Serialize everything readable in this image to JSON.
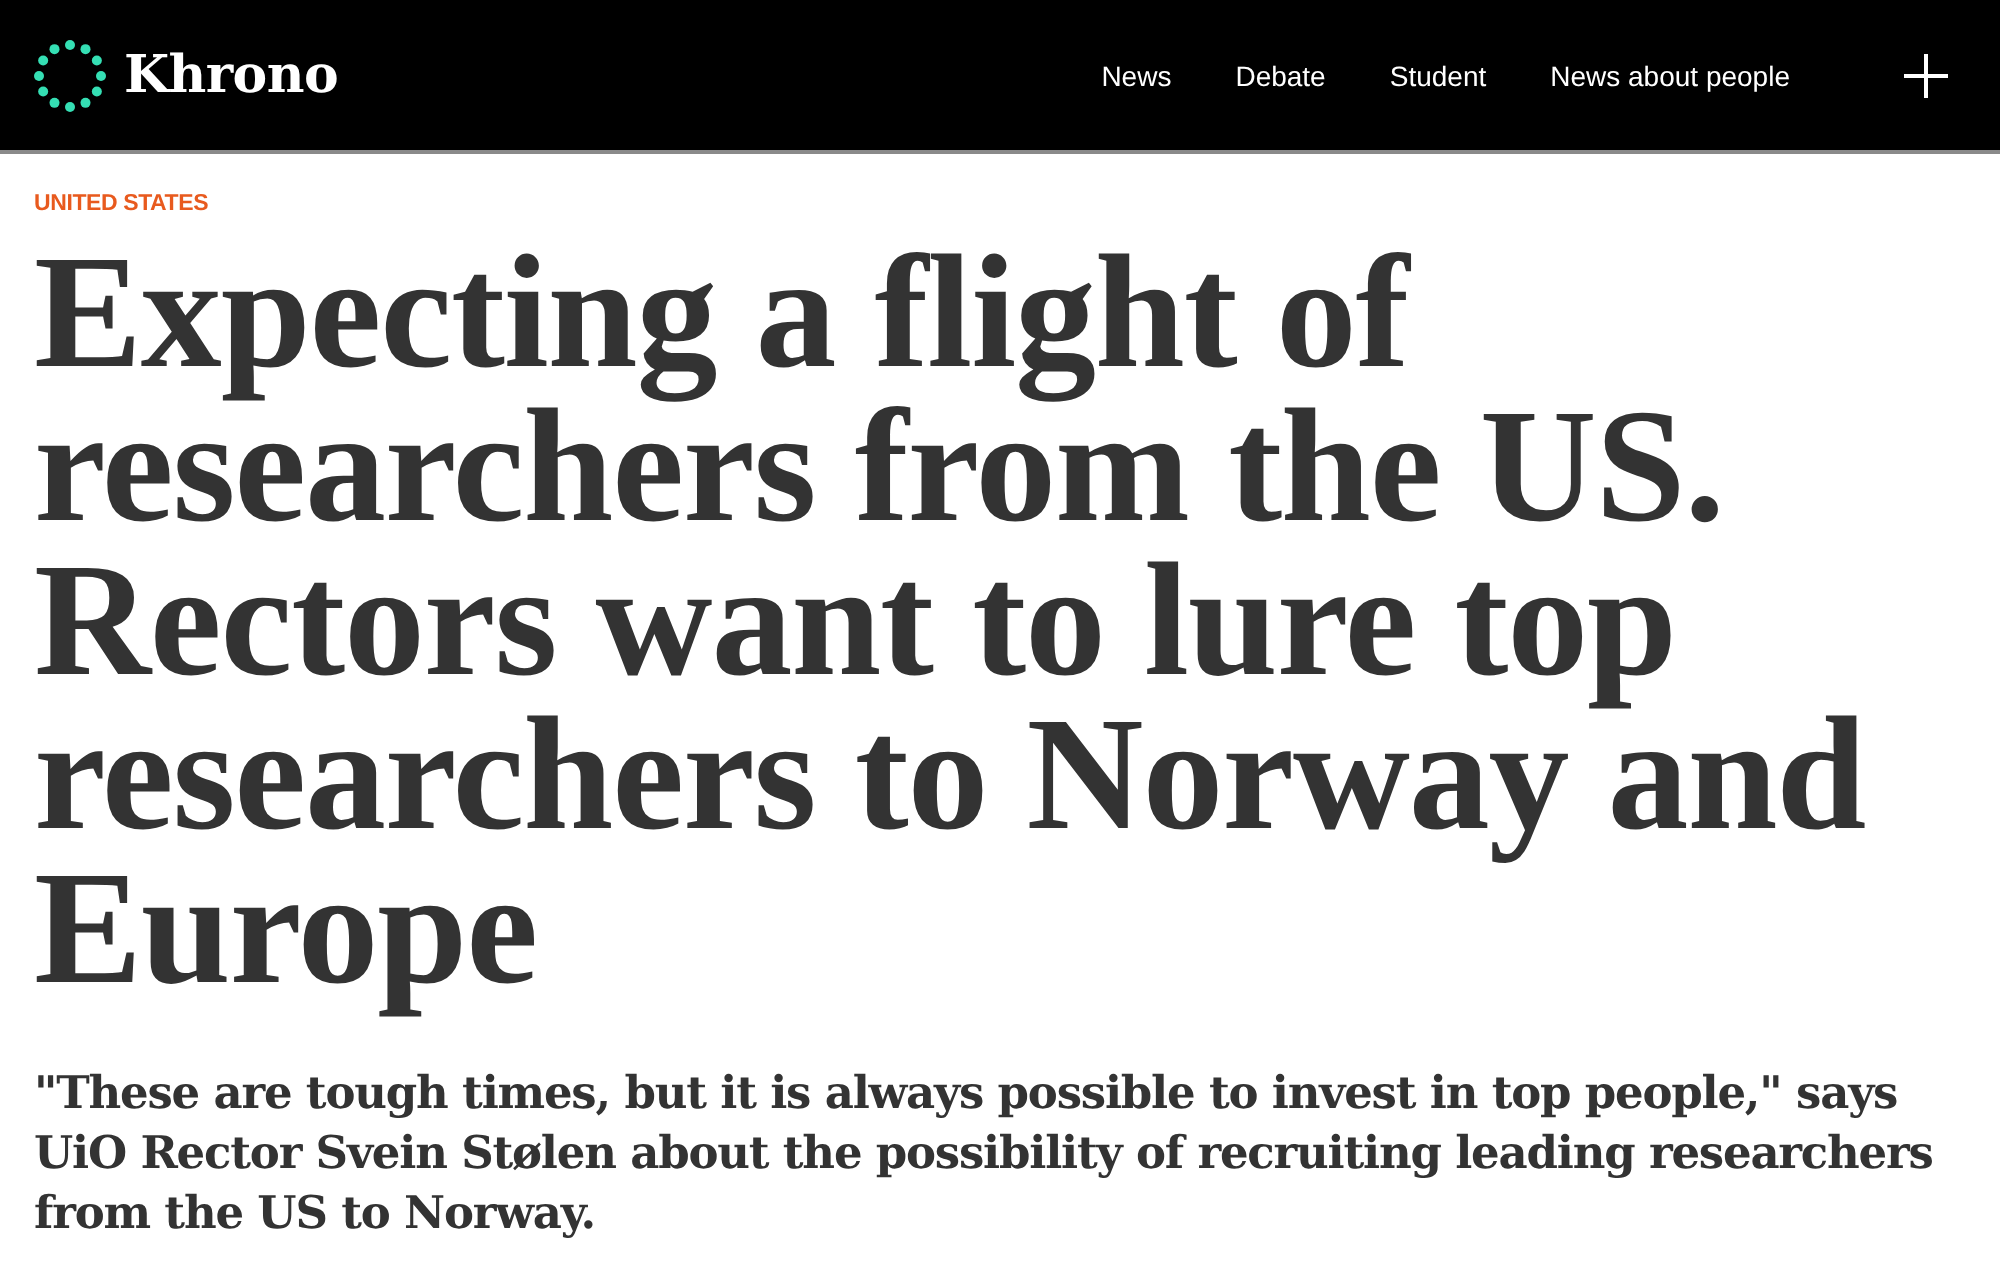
{
  "header": {
    "logo": {
      "wordmark": "Khrono"
    },
    "nav": [
      {
        "label": "News"
      },
      {
        "label": "Debate"
      },
      {
        "label": "Student"
      },
      {
        "label": "News about people"
      }
    ]
  },
  "article": {
    "kicker": "UNITED STATES",
    "headline": "Expecting a flight of researchers from the US. Rectors want to lure top researchers to Norway and Europe",
    "lede": "\"These are tough times, but it is always possible to invest in top people,\" says UiO Rector Svein Stølen about the possibility of recruiting leading researchers from the US to Norway."
  }
}
